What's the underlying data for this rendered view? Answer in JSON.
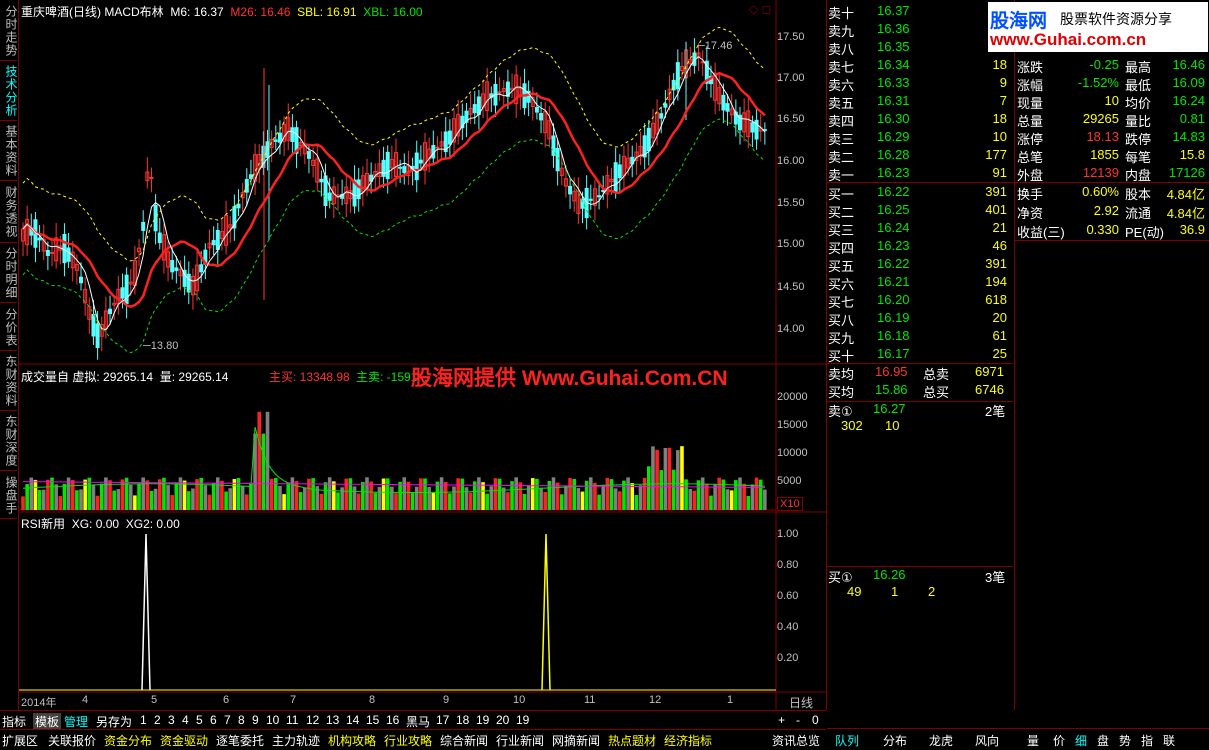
{
  "left_tabs": [
    "分时走势",
    "技术分析",
    "基本资料",
    "财务透视",
    "分时明细",
    "分价表",
    "东财资料",
    "东财深度",
    "操盘手"
  ],
  "main": {
    "title": "重庆啤酒(日线)",
    "indicator": "MACD布林",
    "m6": "M6: 16.37",
    "m26": "M26: 16.46",
    "sbl": "SBL: 16.91",
    "xbl": "XBL: 16.00",
    "high_label": "17.46",
    "low_label": "13.80",
    "price_axis": [
      "17.50",
      "17.00",
      "16.50",
      "16.00",
      "15.50",
      "15.00",
      "14.50",
      "14.00"
    ]
  },
  "volume": {
    "title": "成交量自",
    "virtual": "虚拟: 29265.14",
    "vol": "量: 29265.14",
    "main_buy": "主买: 13348.98",
    "main_sell": "主卖: -1591...",
    "watermark": "股海网提供 Www.Guhai.Com.CN",
    "axis": [
      "20000",
      "15000",
      "10000",
      "5000"
    ],
    "x10": "X10"
  },
  "rsi": {
    "title": "RSI新用",
    "xg": "XG: 0.00",
    "xg2": "XG2: 0.00",
    "axis": [
      "1.00",
      "0.80",
      "0.60",
      "0.40",
      "0.20"
    ]
  },
  "time_axis": {
    "labels": [
      "2014年",
      "4",
      "5",
      "6",
      "7",
      "8",
      "9",
      "10",
      "11",
      "12",
      "1"
    ],
    "period": "日线"
  },
  "sell_orders": [
    {
      "label": "卖十",
      "price": "16.37",
      "vol": ""
    },
    {
      "label": "卖九",
      "price": "16.36",
      "vol": ""
    },
    {
      "label": "卖八",
      "price": "16.35",
      "vol": ""
    },
    {
      "label": "卖七",
      "price": "16.34",
      "vol": "18"
    },
    {
      "label": "卖六",
      "price": "16.33",
      "vol": "9"
    },
    {
      "label": "卖五",
      "price": "16.31",
      "vol": "7"
    },
    {
      "label": "卖四",
      "price": "16.30",
      "vol": "18"
    },
    {
      "label": "卖三",
      "price": "16.29",
      "vol": "10"
    },
    {
      "label": "卖二",
      "price": "16.28",
      "vol": "177"
    },
    {
      "label": "卖一",
      "price": "16.23",
      "vol": "91"
    }
  ],
  "buy_orders": [
    {
      "label": "买一",
      "price": "16.22",
      "vol": "391"
    },
    {
      "label": "买二",
      "price": "16.25",
      "vol": "401"
    },
    {
      "label": "买三",
      "price": "16.24",
      "vol": "21"
    },
    {
      "label": "买四",
      "price": "16.23",
      "vol": "46"
    },
    {
      "label": "买五",
      "price": "16.22",
      "vol": "391"
    },
    {
      "label": "买六",
      "price": "16.21",
      "vol": "194"
    },
    {
      "label": "买七",
      "price": "16.20",
      "vol": "618"
    },
    {
      "label": "买八",
      "price": "16.19",
      "vol": "20"
    },
    {
      "label": "买九",
      "price": "16.18",
      "vol": "61"
    },
    {
      "label": "买十",
      "price": "16.17",
      "vol": "25"
    }
  ],
  "avg": {
    "sell_avg_label": "卖均",
    "sell_avg": "16.95",
    "total_sell_label": "总卖",
    "total_sell": "6971",
    "buy_avg_label": "买均",
    "buy_avg": "15.86",
    "total_buy_label": "总买",
    "total_buy": "6746"
  },
  "sell1_detail": {
    "label": "卖①",
    "price": "16.27",
    "count": "2笔",
    "v1": "302",
    "v2": "10"
  },
  "buy1_detail": {
    "label": "买①",
    "price": "16.26",
    "count": "3笔",
    "v1": "49",
    "v2": "1",
    "v3": "2"
  },
  "stats": [
    {
      "k1": "涨跌",
      "v1": "-0.25",
      "k2": "最高",
      "v2": "16.46"
    },
    {
      "k1": "涨幅",
      "v1": "-1.52%",
      "k2": "最低",
      "v2": "16.09"
    },
    {
      "k1": "现量",
      "v1": "10",
      "k2": "均价",
      "v2": "16.24"
    },
    {
      "k1": "总量",
      "v1": "29265",
      "k2": "量比",
      "v2": "0.81"
    },
    {
      "k1": "涨停",
      "v1": "18.13",
      "k2": "跌停",
      "v2": "14.83"
    },
    {
      "k1": "总笔",
      "v1": "1855",
      "k2": "每笔",
      "v2": "15.8"
    },
    {
      "k1": "外盘",
      "v1": "12139",
      "k2": "内盘",
      "v2": "17126"
    }
  ],
  "stats2": [
    {
      "k1": "换手",
      "v1": "0.60%",
      "k2": "股本",
      "v2": "4.84亿"
    },
    {
      "k1": "净资",
      "v1": "2.92",
      "k2": "流通",
      "v2": "4.84亿"
    },
    {
      "k1": "收益(三)",
      "v1": "0.330",
      "k2": "PE(动)",
      "v2": "36.9"
    }
  ],
  "logo": {
    "brand": "股海网",
    "tagline": "股票软件资源分享",
    "url": "www.Guhai.com.cn"
  },
  "toolbar1": [
    "指标",
    "模板",
    "管理",
    "另存为",
    "1",
    "2",
    "3",
    "4",
    "5",
    "6",
    "7",
    "8",
    "9",
    "10",
    "11",
    "12",
    "13",
    "14",
    "15",
    "16",
    "黑马",
    "17",
    "18",
    "19",
    "20",
    "19",
    "+",
    "-",
    "0"
  ],
  "toolbar2": [
    "扩展区",
    "关联报价",
    "资金分布",
    "资金驱动",
    "逐笔委托",
    "主力轨迹",
    "机构攻略",
    "行业攻略",
    "综合新闻",
    "行业新闻",
    "网摘新闻",
    "热点题材",
    "经济指标",
    "资讯总览"
  ],
  "right_tabs": [
    "队列",
    "分布",
    "龙虎",
    "风向",
    "量",
    "价",
    "细",
    "盘",
    "势",
    "指",
    "联"
  ],
  "colors": {
    "up": "#ff3232",
    "down": "#00e600",
    "yellow": "#ffff00",
    "cyan": "#00ffff",
    "border": "#800000"
  }
}
